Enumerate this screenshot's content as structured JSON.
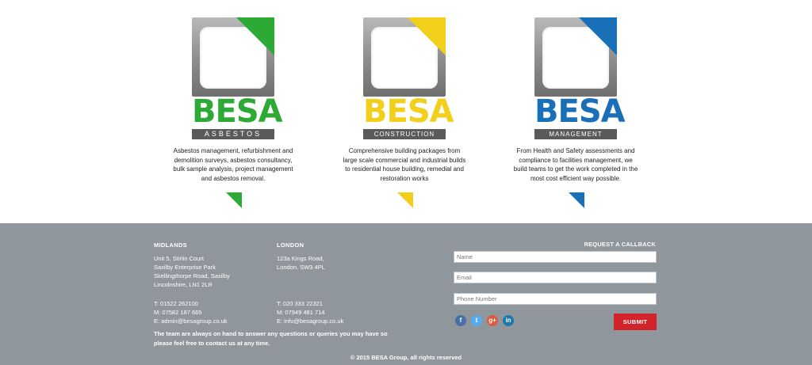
{
  "colors": {
    "asbestos": "#2daa35",
    "construction": "#f2cf1a",
    "management": "#1a70b8",
    "footer_bg": "#8f969c",
    "submit_bg": "#d3232a"
  },
  "brands": [
    {
      "word": "BESA",
      "sub": "ASBESTOS",
      "description": "Asbestos management, refurbishment and demolition surveys, asbestos consultancy, bulk sample analysis, project management and asbestos removal."
    },
    {
      "word": "BESA",
      "sub": "CONSTRUCTION",
      "description": "Comprehensive building packages from large scale commercial and industrial builds to residential house building, remedial and restoration works"
    },
    {
      "word": "BESA",
      "sub": "MANAGEMENT",
      "description": "From Health and Safety assessments and compliance to facilities management, we build teams to get the work completed in the most cost efficient way possible."
    }
  ],
  "footer": {
    "midlands": {
      "heading": "MIDLANDS",
      "address": [
        "Unit 5, Stirlin Court",
        "Saxilby Enterprise Park",
        "Skellingthorpe Road, Saxilby",
        "Lincolnshire, LN1 2LR"
      ],
      "phone": "T: 01522 262100",
      "mobile": "M: 07582 187 665",
      "email": "E: admin@besagroup.co.uk"
    },
    "london": {
      "heading": "LONDON",
      "address": [
        "123a Kings Road,",
        "London, SW3 4PL"
      ],
      "phone": "T: 020 333 22321",
      "mobile": "M: 07949 481 714",
      "email": "E: info@besagroup.co.uk"
    },
    "team_note": "The team are always on hand to answer any questions or queries you may have so please feel free to contact us at any time.",
    "callback": {
      "heading": "REQUEST A CALLBACK",
      "name_placeholder": "Name",
      "email_placeholder": "Email",
      "phone_placeholder": "Phone Number",
      "submit_label": "SUBMIT"
    },
    "social": [
      {
        "icon": "facebook-icon",
        "glyph": "f"
      },
      {
        "icon": "twitter-icon",
        "glyph": "t"
      },
      {
        "icon": "google-plus-icon",
        "glyph": "g+"
      },
      {
        "icon": "linkedin-icon",
        "glyph": "in"
      }
    ],
    "copyright": "© 2015 BESA Group, all rights reserved"
  }
}
